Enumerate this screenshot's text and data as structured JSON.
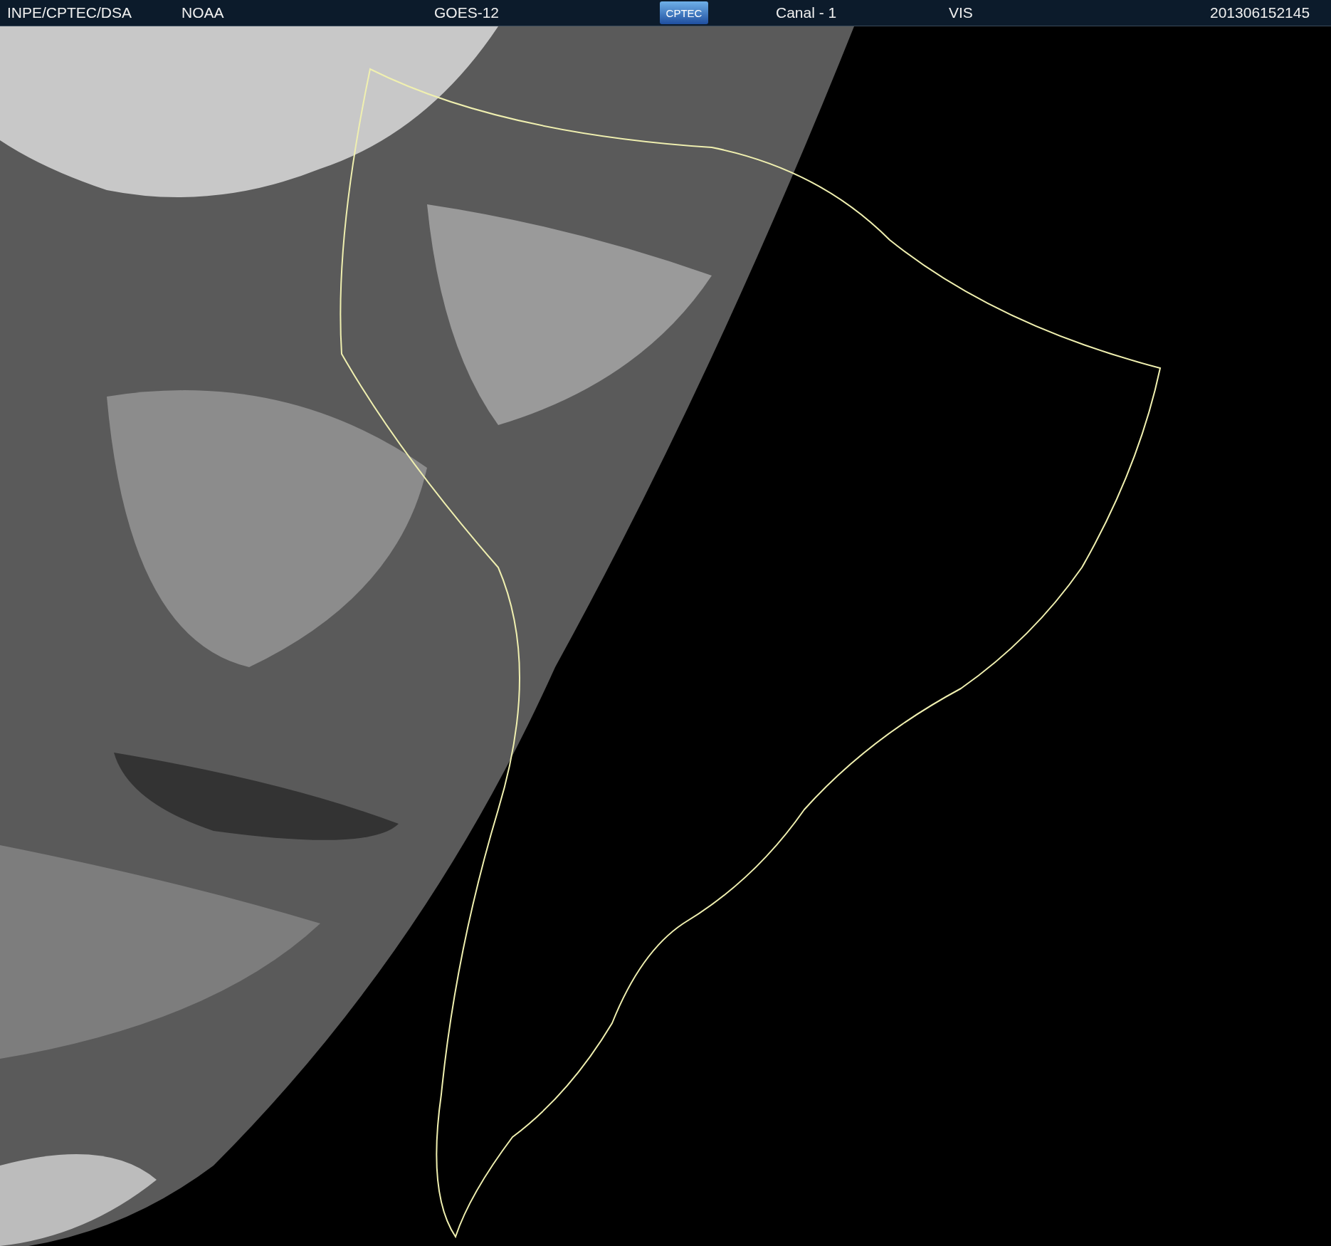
{
  "header": {
    "items": [
      {
        "kind": "text",
        "text": "INPE/CPTEC/DSA"
      },
      {
        "kind": "text",
        "text": "NOAA"
      },
      {
        "kind": "text",
        "text": "GOES-12"
      },
      {
        "kind": "logo",
        "text": "CPTEC"
      },
      {
        "kind": "text",
        "text": "Canal - 1"
      },
      {
        "kind": "text",
        "text": "VIS"
      },
      {
        "kind": "text",
        "text": "201306152145"
      }
    ]
  }
}
